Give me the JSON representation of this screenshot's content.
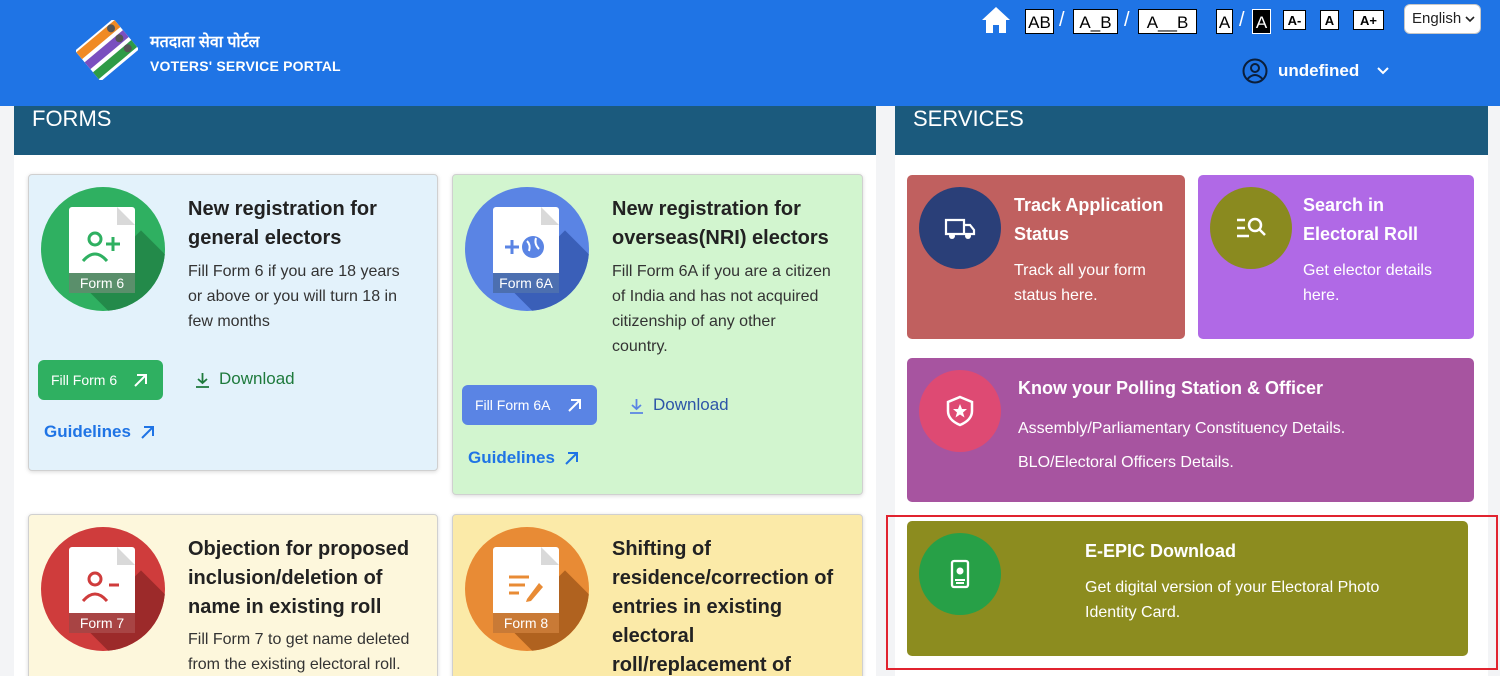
{
  "header": {
    "brand_hindi": "मतदाता सेवा पोर्टल",
    "brand_english": "VOTERS' SERVICE PORTAL",
    "accessibility": {
      "spacing": [
        "AB",
        "A_B",
        "A__B"
      ],
      "contrast": [
        "A",
        "A"
      ],
      "font_size": [
        "A-",
        "A",
        "A+"
      ]
    },
    "language": "English",
    "user_name": "undefined"
  },
  "forms": {
    "title": "FORMS",
    "cards": [
      {
        "badge": "Form 6",
        "title_lines": [
          "New registration for",
          "general electors"
        ],
        "desc_lines": [
          "Fill Form 6 if you are 18 years",
          "or above or you will turn 18 in",
          "few months"
        ],
        "fill_label": "Fill Form 6",
        "download_label": "Download",
        "guidelines_label": "Guidelines"
      },
      {
        "badge": "Form 6A",
        "title_lines": [
          "New registration for",
          "overseas(NRI) electors"
        ],
        "desc_lines": [
          "Fill Form 6A if you are a citizen",
          "of India and has not acquired",
          "citizenship of any other",
          "country."
        ],
        "fill_label": "Fill Form 6A",
        "download_label": "Download",
        "guidelines_label": "Guidelines"
      },
      {
        "badge": "Form 7",
        "title_lines": [
          "Objection for proposed",
          "inclusion/deletion of",
          "name in existing roll"
        ],
        "desc_lines": [
          "Fill Form 7 to get name deleted",
          "from the existing electoral roll."
        ]
      },
      {
        "badge": "Form 8",
        "title_lines": [
          "Shifting of",
          "residence/correction of",
          "entries in existing",
          "electoral",
          "roll/replacement of"
        ]
      }
    ]
  },
  "services": {
    "title": "SERVICES",
    "cards": [
      {
        "title_lines": [
          "Track Application",
          "Status"
        ],
        "desc_lines": [
          "Track all your form",
          "status here."
        ]
      },
      {
        "title_lines": [
          "Search in",
          "Electoral Roll"
        ],
        "desc_lines": [
          "Get elector details",
          "here."
        ]
      },
      {
        "title_lines": [
          "Know your Polling Station & Officer"
        ],
        "desc_lines": [
          "Assembly/Parliamentary Constituency Details.",
          "BLO/Electoral Officers Details."
        ]
      },
      {
        "title_lines": [
          "E-EPIC Download"
        ],
        "desc_lines": [
          "Get digital version of your Electoral Photo",
          "Identity Card."
        ]
      }
    ]
  },
  "colors": {
    "header_blue": "#1f74e5",
    "panel_head": "#1b5a7d",
    "track": "#c0605f",
    "search": "#b069e6",
    "polling": "#a754a0",
    "epic": "#8c8c1f",
    "highlight": "#e1232f"
  }
}
